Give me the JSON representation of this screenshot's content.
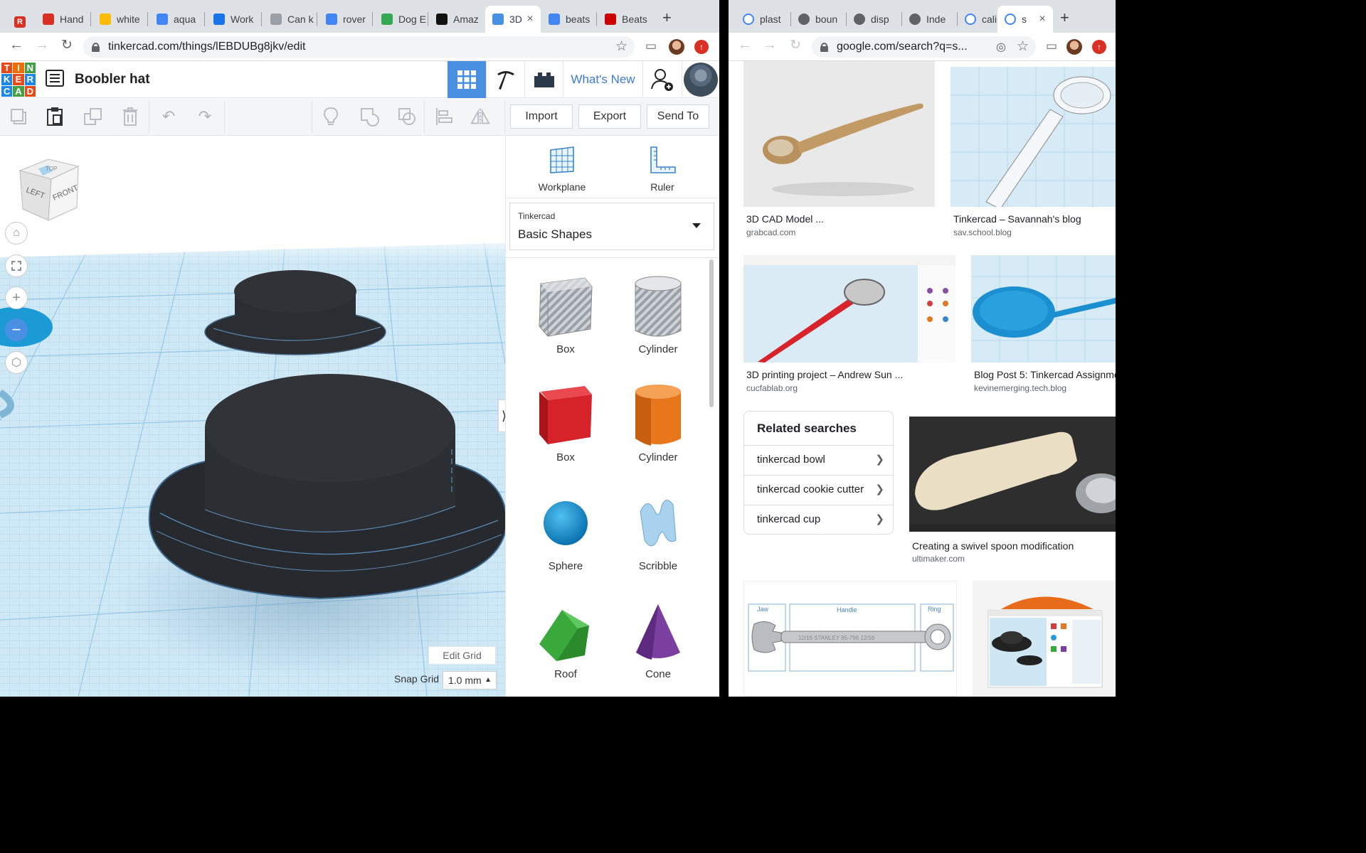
{
  "left_window": {
    "tabs": [
      {
        "label": "Hand",
        "icon": "hand-favicon",
        "color": "#d93025"
      },
      {
        "label": "white",
        "icon": "walmart-favicon",
        "color": "#fbbc05"
      },
      {
        "label": "aqua",
        "icon": "google-favicon",
        "color": "#4285f4"
      },
      {
        "label": "Work",
        "icon": "info-favicon",
        "color": "#1a73e8"
      },
      {
        "label": "Can k",
        "icon": "moon-favicon",
        "color": "#9aa0a6"
      },
      {
        "label": "rover",
        "icon": "google-favicon",
        "color": "#4285f4"
      },
      {
        "label": "Dog E",
        "icon": "paw-favicon",
        "color": "#34a853"
      },
      {
        "label": "Amaz",
        "icon": "amazon-favicon",
        "color": "#111111"
      },
      {
        "label": "3D",
        "icon": "tinkercad-favicon",
        "color": "#4a90e2"
      },
      {
        "label": "beats",
        "icon": "google-favicon",
        "color": "#4285f4"
      },
      {
        "label": "Beats",
        "icon": "target-favicon",
        "color": "#cc0000"
      }
    ],
    "address": "tinkercad.com/things/lEBDUBg8jkv/edit"
  },
  "tinkercad": {
    "logo_letters": [
      "T",
      "I",
      "N",
      "K",
      "E",
      "R",
      "C",
      "A",
      "D"
    ],
    "logo_colors": [
      "#e64a19",
      "#ef6c00",
      "#43a047",
      "#1e88e5",
      "#e64a19",
      "#1e88e5",
      "#1e88e5",
      "#43a047",
      "#e64a19"
    ],
    "design_name": "Boobler hat",
    "whats_new": "What's New",
    "import_label": "Import",
    "export_label": "Export",
    "send_to_label": "Send To",
    "workplane_label": "Workplane",
    "ruler_label": "Ruler",
    "library_source": "Tinkercad",
    "library_name": "Basic Shapes",
    "view_cube": {
      "top": "TOP",
      "left": "LEFT",
      "front": "FRONT"
    },
    "shapes": [
      {
        "label": "Box",
        "icon": "box-hole-icon"
      },
      {
        "label": "Cylinder",
        "icon": "cylinder-hole-icon"
      },
      {
        "label": "Box",
        "icon": "box-icon",
        "color": "#d6232a"
      },
      {
        "label": "Cylinder",
        "icon": "cylinder-icon",
        "color": "#e8771c"
      },
      {
        "label": "Sphere",
        "icon": "sphere-icon",
        "color": "#1c9bd6"
      },
      {
        "label": "Scribble",
        "icon": "scribble-icon",
        "color": "#8fc3e6"
      },
      {
        "label": "Roof",
        "icon": "roof-icon",
        "color": "#3aa93c"
      },
      {
        "label": "Cone",
        "icon": "cone-icon",
        "color": "#7b3fa0"
      }
    ],
    "edit_grid": "Edit Grid",
    "snap_grid_label": "Snap Grid",
    "snap_grid_value": "1.0 mm"
  },
  "right_window": {
    "tabs": [
      {
        "label": "plast",
        "icon": "google-favicon"
      },
      {
        "label": "boun",
        "icon": "globe-favicon"
      },
      {
        "label": "disp",
        "icon": "globe-favicon"
      },
      {
        "label": "Inde",
        "icon": "globe-favicon"
      },
      {
        "label": "calip",
        "icon": "google-favicon"
      },
      {
        "label": "s",
        "icon": "google-favicon"
      }
    ],
    "address": "google.com/search?q=s..."
  },
  "results": [
    {
      "title": "3D CAD Model ...",
      "source": "grabcad.com"
    },
    {
      "title": "Tinkercad – Savannah's blog",
      "source": "sav.school.blog"
    },
    {
      "title": "3D printing project – Andrew Sun ...",
      "source": "cucfablab.org"
    },
    {
      "title": "Blog Post 5: Tinkercad Assignme",
      "source": "kevinemerging.tech.blog"
    },
    {
      "title": "Creating a swivel spoon modification",
      "source": "ultimaker.com"
    }
  ],
  "related": {
    "heading": "Related searches",
    "items": [
      "tinkercad bowl",
      "tinkercad cookie cutter",
      "tinkercad cup"
    ]
  },
  "wrench_labels": {
    "jaw": "Jaw",
    "handle": "Handle",
    "ring": "Ring",
    "stamp": "12/16   STANLEY 85-796   12/16"
  }
}
